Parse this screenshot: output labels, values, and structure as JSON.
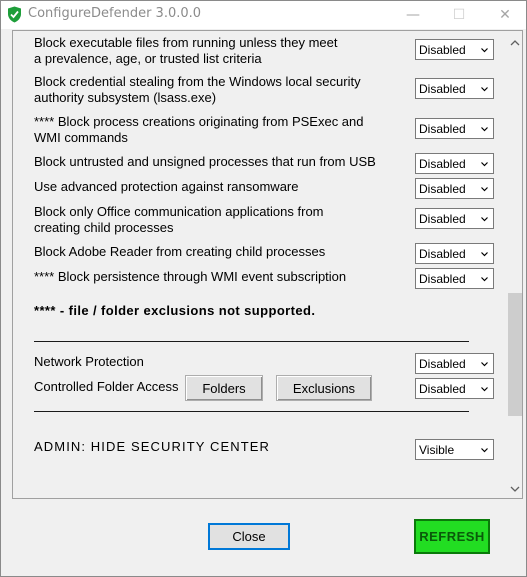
{
  "window": {
    "title": "ConfigureDefender 3.0.0.0",
    "minimize_glyph": "—",
    "maximize_glyph": "☐",
    "close_glyph": "✕"
  },
  "rules": [
    {
      "label": "Block executable files from running unless they meet\na prevalence, age, or trusted list criteria",
      "value": "Disabled"
    },
    {
      "label": "Block credential stealing from the Windows local security\nauthority subsystem (lsass.exe)",
      "value": "Disabled"
    },
    {
      "label": "**** Block process creations originating from PSExec and\nWMI commands",
      "value": "Disabled"
    },
    {
      "label": "Block untrusted and unsigned processes that run from USB",
      "value": "Disabled"
    },
    {
      "label": "Use advanced protection against ransomware",
      "value": "Disabled"
    },
    {
      "label": "Block only Office communication applications from\ncreating child processes",
      "value": "Disabled"
    },
    {
      "label": "Block Adobe Reader from creating child processes",
      "value": "Disabled"
    },
    {
      "label": "**** Block persistence through WMI event subscription",
      "value": "Disabled"
    }
  ],
  "note": "**** - file / folder exclusions not supported.",
  "network_protection": {
    "label": "Network Protection",
    "value": "Disabled"
  },
  "controlled_folder_access": {
    "label": "Controlled Folder Access",
    "value": "Disabled",
    "folders_button": "Folders",
    "exclusions_button": "Exclusions"
  },
  "admin": {
    "label": "ADMIN:  HIDE  SECURITY  CENTER",
    "value": "Visible"
  },
  "footer": {
    "close_label": "Close",
    "refresh_label": "REFRESH"
  },
  "colors": {
    "refresh_bg": "#22dd22",
    "refresh_border": "#0a7a0a",
    "icon_green": "#1e9e3a"
  }
}
